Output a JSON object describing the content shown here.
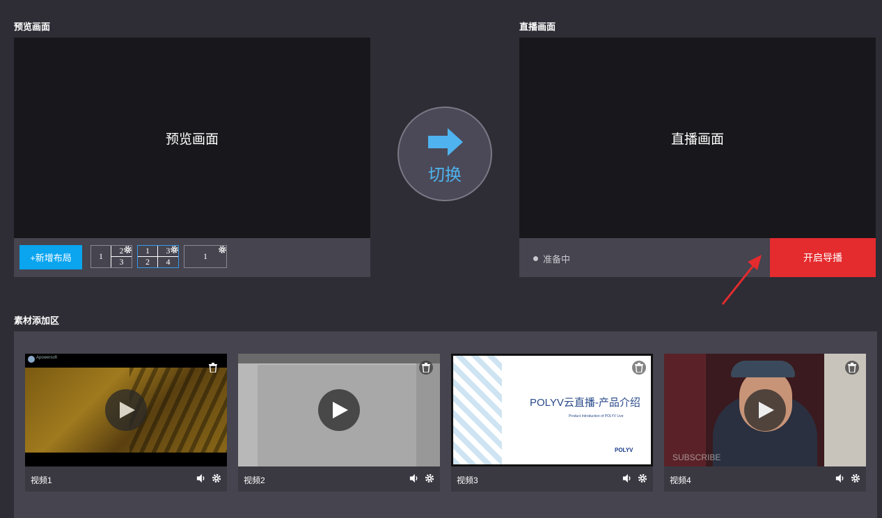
{
  "preview": {
    "title": "预览画面",
    "screen_text": "预览画面"
  },
  "live": {
    "title": "直播画面",
    "screen_text": "直播画面",
    "status": "准备中",
    "start_label": "开启导播"
  },
  "switch": {
    "label": "切换"
  },
  "layout": {
    "add_label": "+新增布局",
    "options": [
      {
        "cells": [
          "1",
          "2",
          "3"
        ]
      },
      {
        "cells": [
          "1",
          "3",
          "2",
          "4"
        ]
      },
      {
        "cells": [
          "1"
        ]
      }
    ]
  },
  "materials": {
    "title": "素材添加区",
    "items": [
      {
        "name": "视频1",
        "thumb_text": "Apowersoft"
      },
      {
        "name": "视频2"
      },
      {
        "name": "视频3",
        "thumb_title": "POLYV云直播-产品介绍",
        "thumb_subtitle": "Product Introduction of POLYV Live",
        "thumb_brand": "POLYV"
      },
      {
        "name": "视频4",
        "thumb_text": "SUBSCRIBE"
      }
    ]
  },
  "colors": {
    "accent_blue": "#0aa4ef",
    "start_red": "#e42b2e",
    "switch_blue": "#4fb3ef"
  },
  "icons": [
    "switch-arrow-icon",
    "gear-icon",
    "play-icon",
    "trash-icon",
    "volume-icon",
    "status-dot-icon"
  ]
}
